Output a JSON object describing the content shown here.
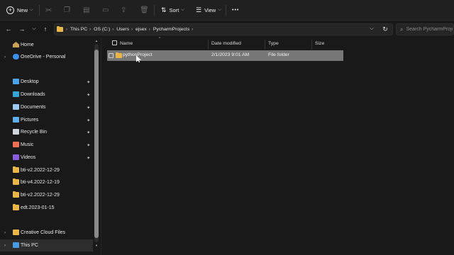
{
  "toolbar": {
    "new_label": "New",
    "sort_label": "Sort",
    "view_label": "View",
    "more_label": "•••"
  },
  "address": {
    "crumbs": [
      "This PC",
      "OS (C:)",
      "Users",
      "ejsex",
      "PycharmProjects"
    ],
    "search_placeholder": "Search PycharmProjects"
  },
  "sidebar": {
    "items": [
      {
        "label": "Home",
        "icon": "home-icon"
      },
      {
        "label": "OneDrive - Personal",
        "icon": "onedrive-icon"
      },
      {
        "label": "Desktop",
        "icon": "desktop-icon",
        "pinned": true
      },
      {
        "label": "Downloads",
        "icon": "downloads-icon",
        "pinned": true
      },
      {
        "label": "Documents",
        "icon": "documents-icon",
        "pinned": true
      },
      {
        "label": "Pictures",
        "icon": "pictures-icon",
        "pinned": true
      },
      {
        "label": "Recycle Bin",
        "icon": "recycle-bin-icon",
        "pinned": true
      },
      {
        "label": "Music",
        "icon": "music-icon",
        "pinned": true
      },
      {
        "label": "Videos",
        "icon": "videos-icon",
        "pinned": true
      },
      {
        "label": "bti-v2.2022-12-29",
        "icon": "folder-icon"
      },
      {
        "label": "bti-v4.2022-12-19",
        "icon": "folder-icon"
      },
      {
        "label": "bti-v2.2022-12-29",
        "icon": "folder-icon"
      },
      {
        "label": "edt.2023-01-15",
        "icon": "folder-icon"
      },
      {
        "label": "Creative Cloud Files",
        "icon": "creative-cloud-icon"
      },
      {
        "label": "This PC",
        "icon": "this-pc-icon",
        "selected": true
      }
    ]
  },
  "columns": {
    "name": "Name",
    "date": "Date modified",
    "type": "Type",
    "size": "Size"
  },
  "files": [
    {
      "name": "pythonProject",
      "date": "2/1/2023 9:01 AM",
      "type": "File folder",
      "size": ""
    }
  ],
  "colors": {
    "background": "#191919",
    "toolbar": "#202020",
    "selected_row": "#777777",
    "folder": "#e9b647"
  }
}
